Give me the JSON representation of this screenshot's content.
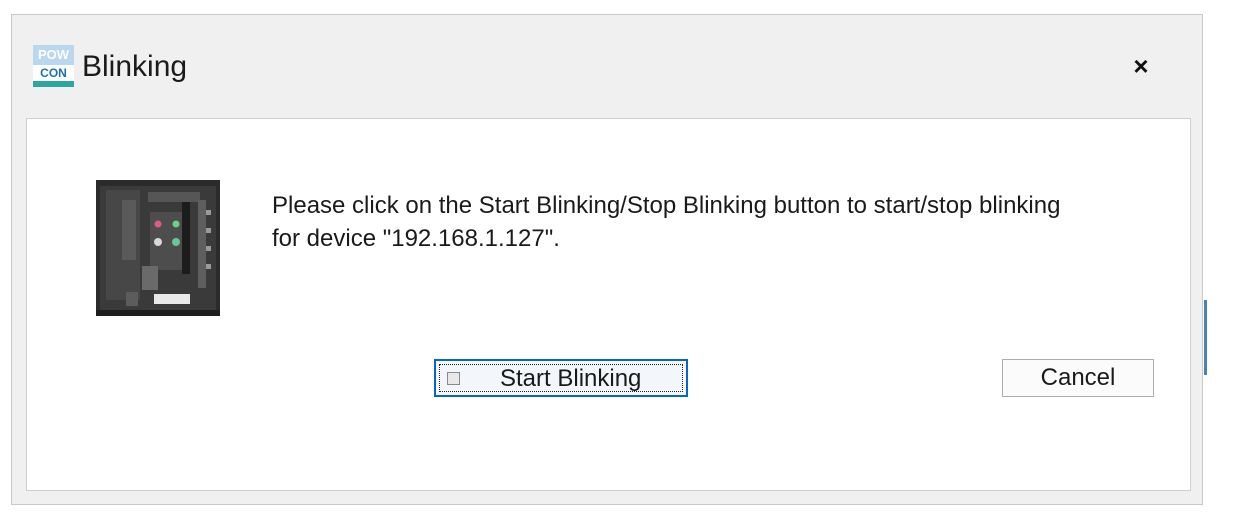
{
  "dialog": {
    "title": "Blinking",
    "app_icon": {
      "name": "powcon-logo-icon",
      "top_text": "POW",
      "bottom_text": "CON",
      "colors": {
        "top": "#b9d7ef",
        "bottom_text": "#1f6fb5",
        "bar": "#2aa7a3"
      }
    },
    "close_icon": "close-icon",
    "close_glyph": "×"
  },
  "content": {
    "device_image": "circuit-breaker-device-image",
    "message_line1": "Please click on the Start Blinking/Stop Blinking button to start/stop blinking",
    "message_line2": "for device \"192.168.1.127\"."
  },
  "buttons": {
    "start_label": "Start Blinking",
    "cancel_label": "Cancel"
  },
  "colors": {
    "focus_border": "#0a64c8",
    "dialog_bg": "#f0f0f0",
    "content_bg": "#ffffff"
  }
}
